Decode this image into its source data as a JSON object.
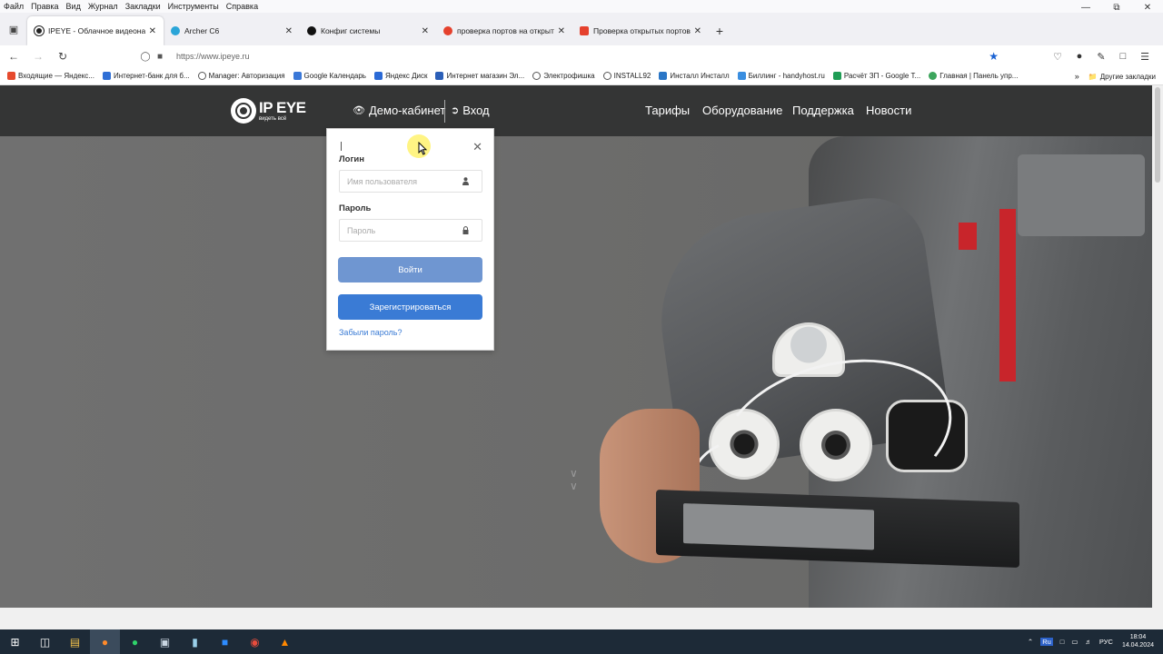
{
  "menubar": {
    "items": [
      "Файл",
      "Правка",
      "Вид",
      "Журнал",
      "Закладки",
      "Инструменты",
      "Справка"
    ]
  },
  "tabs": [
    {
      "label": "IPEYE - Облачное видеонабл",
      "active": true,
      "icon_color": "#222222"
    },
    {
      "label": "Archer C6",
      "active": false,
      "icon_color": "#2aa5d8"
    },
    {
      "label": "Конфиг системы",
      "active": false,
      "icon_color": "#111111"
    },
    {
      "label": "проверка портов на открыто",
      "active": false,
      "icon_color": "#e5412d"
    },
    {
      "label": "Проверка открытых портов |",
      "active": false,
      "icon_color": "#e5412d"
    }
  ],
  "nav": {
    "url": "https://www.ipeye.ru"
  },
  "bookmarks": {
    "items": [
      {
        "label": "Входящие — Яндекс...",
        "color": "#e64a2e"
      },
      {
        "label": "Интернет-банк для б...",
        "color": "#2f6fd6"
      },
      {
        "label": "Manager: Авторизация",
        "color": "#555555"
      },
      {
        "label": "Google Календарь",
        "color": "#3a78d8"
      },
      {
        "label": "Яндекс Диск",
        "color": "#2b6ad6"
      },
      {
        "label": "Интернет магазин Эл...",
        "color": "#2b5fb8"
      },
      {
        "label": "Электрофишка",
        "color": "#555555"
      },
      {
        "label": "INSTALL92",
        "color": "#555555"
      },
      {
        "label": "Инсталл Инсталл",
        "color": "#2a76c6"
      },
      {
        "label": "Биллинг - handyhost.ru",
        "color": "#3a8ee0"
      },
      {
        "label": "Расчёт ЗП - Google Т...",
        "color": "#1f9d55"
      },
      {
        "label": "Главная | Панель упр...",
        "color": "#3ca55c"
      }
    ],
    "other_label": "Другие закладки"
  },
  "site": {
    "logo_main": "IP EYE",
    "logo_tagline": "видеть всё",
    "demo_label": "Демо-кабинет",
    "login_label": "Вход",
    "nav": [
      "Тарифы",
      "Оборудование",
      "Поддержка",
      "Новости"
    ]
  },
  "login_form": {
    "login_label": "Логин",
    "login_placeholder": "Имя пользователя",
    "password_label": "Пароль",
    "password_placeholder": "Пароль",
    "submit_label": "Войти",
    "register_label": "Зарегистрироваться",
    "forgot_label": "Забыли пароль?"
  },
  "colors": {
    "header_bg": "#343535",
    "submit_btn": "#6f96d1",
    "register_btn": "#3a7bd5",
    "star": "#1a62d3"
  },
  "taskbar": {
    "lang": "РУС",
    "time": "18:04",
    "date": "14.04.2024"
  }
}
